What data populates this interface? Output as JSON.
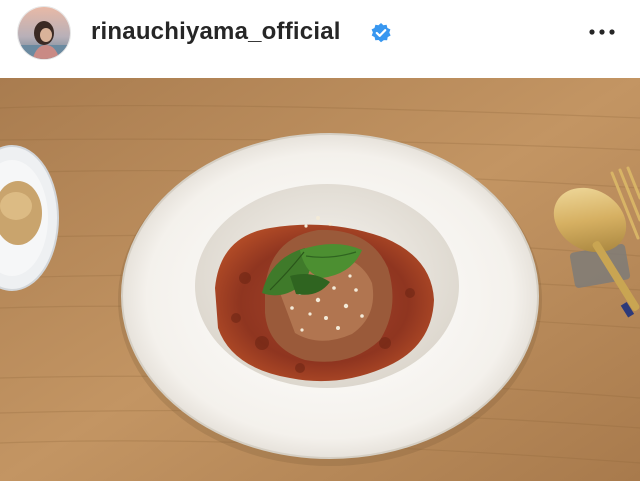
{
  "post": {
    "username": "rinauchiyama_official",
    "verified": true,
    "photo_alt": "Plate of meat with tomato sauce, cheese and basil on a wooden table"
  },
  "icons": {
    "verified": "verified-badge-icon",
    "more": "more-options-icon"
  },
  "colors": {
    "verified_badge": "#3897f0",
    "username_text": "#262626",
    "table_wood": "#b88a58"
  }
}
